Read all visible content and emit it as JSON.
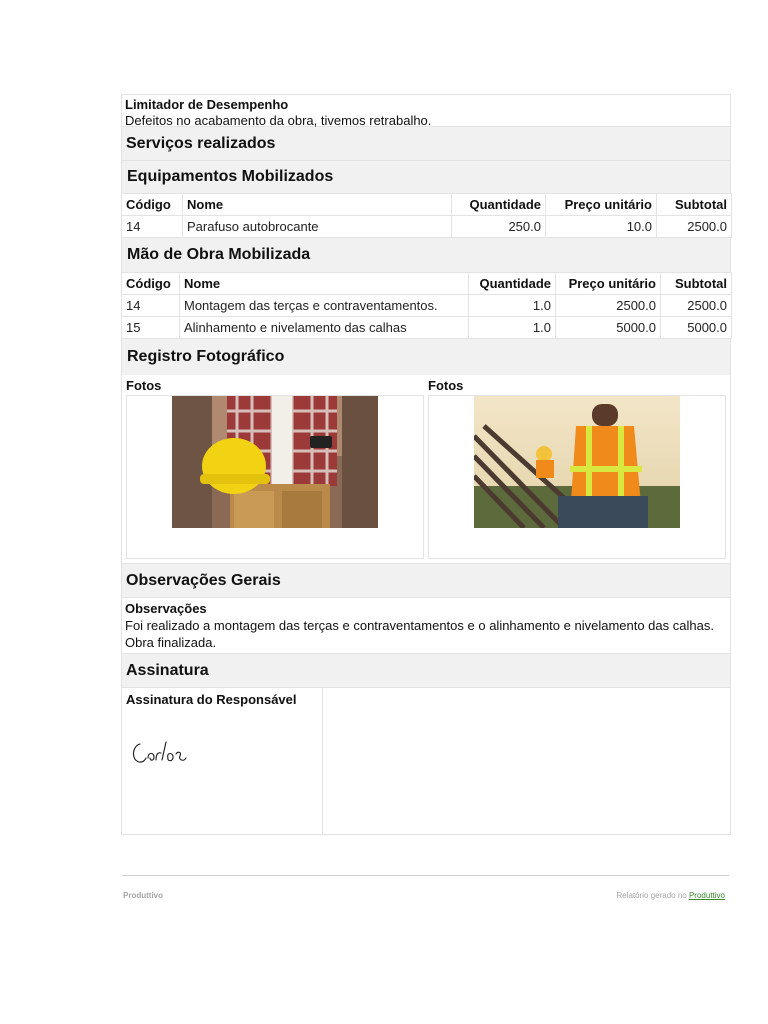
{
  "limiter": {
    "label": "Limitador de Desempenho",
    "value": "Defeitos no acabamento da obra, tivemos retrabalho."
  },
  "services": {
    "title": "Serviços realizados"
  },
  "equipment": {
    "title": "Equipamentos Mobilizados",
    "headers": [
      "Código",
      "Nome",
      "Quantidade",
      "Preço unitário",
      "Subtotal"
    ],
    "rows": [
      [
        "14",
        "Parafuso autobrocante",
        "250.0",
        "10.0",
        "2500.0"
      ]
    ]
  },
  "labor": {
    "title": "Mão de Obra Mobilizada",
    "headers": [
      "Código",
      "Nome",
      "Quantidade",
      "Preço unitário",
      "Subtotal"
    ],
    "rows": [
      [
        "14",
        "Montagem das terças e contraventamentos.",
        "1.0",
        "2500.0",
        "2500.0"
      ],
      [
        "15",
        "Alinhamento e nivelamento das calhas",
        "1.0",
        "5000.0",
        "5000.0"
      ]
    ]
  },
  "photos": {
    "title": "Registro Fotográfico",
    "items": [
      {
        "label": "Fotos"
      },
      {
        "label": "Fotos"
      }
    ]
  },
  "observations": {
    "title": "Observações Gerais",
    "label": "Observações",
    "line1": "Foi realizado a montagem das terças e contraventamentos e o alinhamento e nivelamento das calhas.",
    "line2": "Obra finalizada."
  },
  "signature": {
    "title": "Assinatura",
    "label": "Assinatura do Responsável",
    "name": "Carlos"
  },
  "footer": {
    "left": "Produttivo",
    "right_prefix": "Relatório gerado no",
    "right_link": "Produttivo"
  }
}
